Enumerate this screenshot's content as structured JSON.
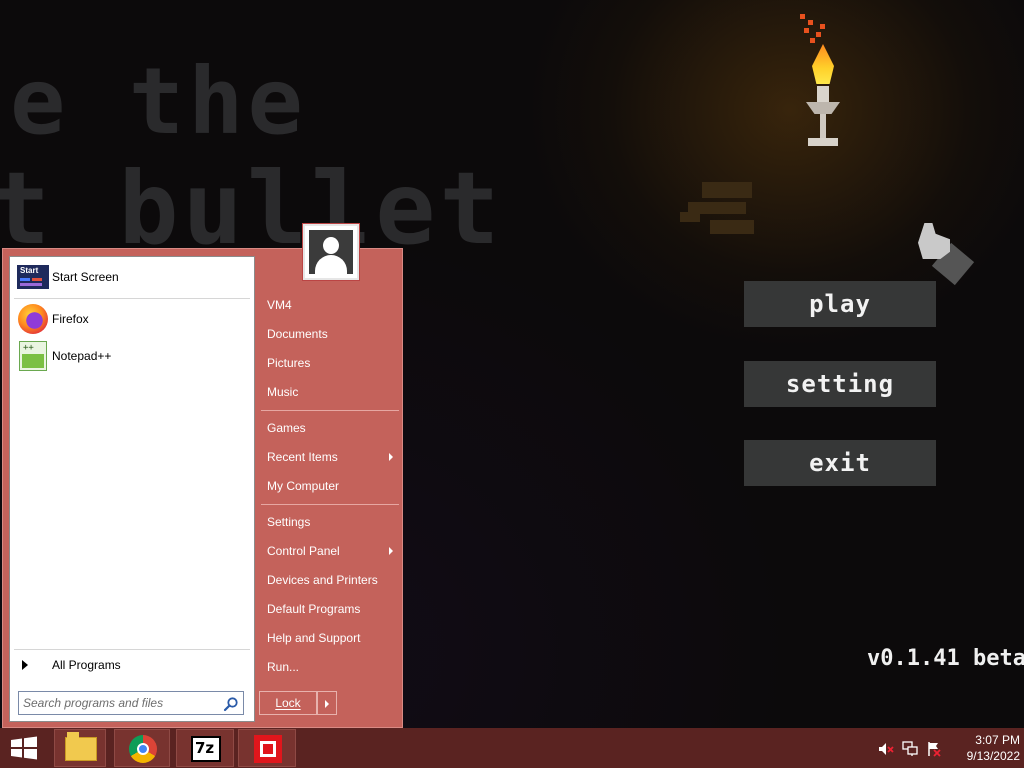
{
  "game": {
    "title_line_1": "e the",
    "title_line_2": "t bullet",
    "menu": {
      "play": "play",
      "setting": "setting",
      "exit": "exit"
    },
    "version": "v0.1.41 beta"
  },
  "start_menu": {
    "pinned": [
      {
        "label": "Start Screen",
        "icon": "start-screen-icon"
      },
      {
        "label": "Firefox",
        "icon": "firefox-icon"
      },
      {
        "label": "Notepad++",
        "icon": "notepad-plus-plus-icon"
      }
    ],
    "all_programs": "All Programs",
    "search_placeholder": "Search programs and files",
    "places": [
      {
        "label": "VM4"
      },
      {
        "label": "Documents"
      },
      {
        "label": "Pictures"
      },
      {
        "label": "Music"
      },
      {
        "label": "Games"
      },
      {
        "label": "Recent Items",
        "submenu": true
      },
      {
        "label": "My Computer"
      },
      {
        "label": "Settings"
      },
      {
        "label": "Control Panel",
        "submenu": true
      },
      {
        "label": "Devices and Printers"
      },
      {
        "label": "Default Programs"
      },
      {
        "label": "Help and Support"
      },
      {
        "label": "Run..."
      }
    ],
    "power_button": "Lock"
  },
  "taskbar": {
    "apps": [
      {
        "name": "File Explorer",
        "icon": "folder-icon"
      },
      {
        "name": "Google Chrome",
        "icon": "chrome-icon"
      },
      {
        "name": "7-Zip",
        "icon": "7zip-icon",
        "glyph": "7z"
      },
      {
        "name": "App",
        "icon": "red-square-app-icon"
      }
    ],
    "tray": {
      "icons": [
        "volume-muted-icon",
        "network-icon",
        "action-center-icon"
      ],
      "time": "3:07 PM",
      "date": "9/13/2022"
    }
  },
  "colors": {
    "start_menu_bg": "#c4625b",
    "taskbar_bg": "#5a2321",
    "game_button_bg": "#363737"
  }
}
